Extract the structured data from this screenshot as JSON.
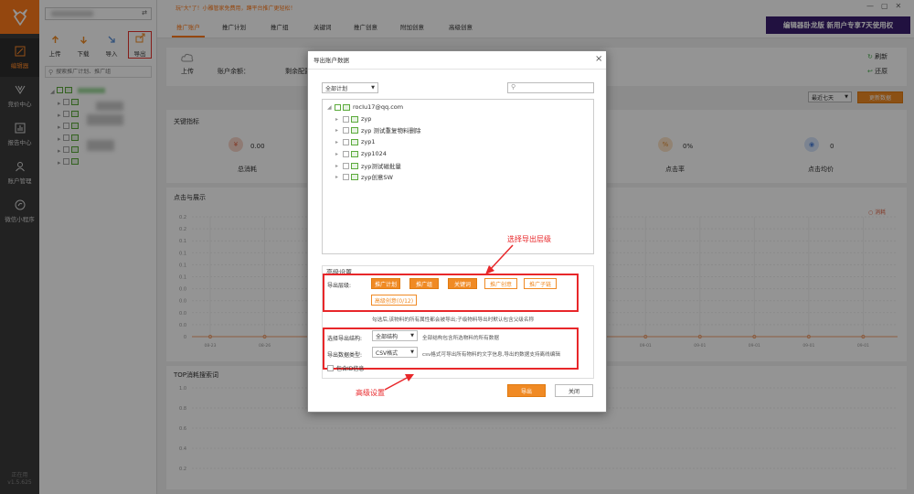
{
  "sidebar": {
    "items": [
      {
        "label": "编辑器",
        "icon": "edit-icon"
      },
      {
        "label": "竞价中心",
        "icon": "bid-icon"
      },
      {
        "label": "报告中心",
        "icon": "chart-icon"
      },
      {
        "label": "账户管理",
        "icon": "user-icon"
      },
      {
        "label": "微信小程序",
        "icon": "mini-program-icon"
      }
    ],
    "version_1": "正在用",
    "version_2": "v1.5.625"
  },
  "toolbar": {
    "upload": "上传",
    "download": "下载",
    "import": "导入",
    "export": "导出"
  },
  "search": {
    "placeholder": "搜索推广计划、推广组"
  },
  "notice": "玩\"大\"了！小雕管家免费用，蹲平台推广更轻松！",
  "tabs": [
    "推广账户",
    "推广计划",
    "推广组",
    "关键词",
    "推广创意",
    "附加创意",
    "高级创意"
  ],
  "ad": {
    "text": "编辑器卧龙版 新用户专享7天使用权"
  },
  "account": {
    "upload": "上传",
    "balance_label": "账户余额：",
    "budget_label": "剩余配置",
    "refresh": "刷新",
    "restore": "还原",
    "range": "最近七天",
    "update": "更新数据"
  },
  "metrics": {
    "title": "关键指标",
    "items": [
      {
        "value": "0.00",
        "label": "总消耗"
      },
      {
        "value": "0%",
        "label": "点击率"
      },
      {
        "value": "0",
        "label": "点击均价"
      }
    ]
  },
  "chart": {
    "title": "点击与展示",
    "legend": "消耗",
    "yticks": [
      "0.2",
      "0.2",
      "0.1",
      "0.1",
      "0.1",
      "0.1",
      "0.0",
      "0.0",
      "0.0",
      "0.0",
      "0"
    ],
    "xticks": [
      "08-23",
      "08-26",
      "08-29",
      "09-01",
      "09-01",
      "09-01",
      "09-01",
      "08-30",
      "09-01",
      "09-01",
      "09-01",
      "09-01",
      "09-01"
    ]
  },
  "top": {
    "title": "TOP消耗搜索词",
    "yticks": [
      "1.0",
      "0.8",
      "0.6",
      "0.4",
      "0.2"
    ]
  },
  "dialog": {
    "title": "导出账户数据",
    "plan_select": "全部计划",
    "tree_root": "rocIu17@qq.com",
    "tree_items": [
      "zyp",
      "zyp 测试重复物料删除",
      "zyp1",
      "zyp1024",
      "zyp测试磁批量",
      "zyp创意SW"
    ],
    "section_title": "高级设置",
    "level_label": "导出层级:",
    "levels": [
      "推广计划",
      "推广组",
      "关键词",
      "推广创意",
      "推广子链",
      "高级创意(0/12)"
    ],
    "hint": "勾选后,该物料的所有属性都会被导出;子级物料导出时默认包含父级名称",
    "structure_label": "选择导出结构:",
    "structure_value": "全部结构",
    "structure_hint": "全部结构包含所选物料的所有数据",
    "type_label": "导出数据类型:",
    "type_value": "CSV格式",
    "type_hint": "csv格式可导出所有物料的文字信息,导出的数据支持离线编辑",
    "include_id": "包含ID信息",
    "export_btn": "导出",
    "close_btn": "关闭"
  },
  "annotations": {
    "level": "选择导出层级",
    "advanced": "高级设置"
  }
}
